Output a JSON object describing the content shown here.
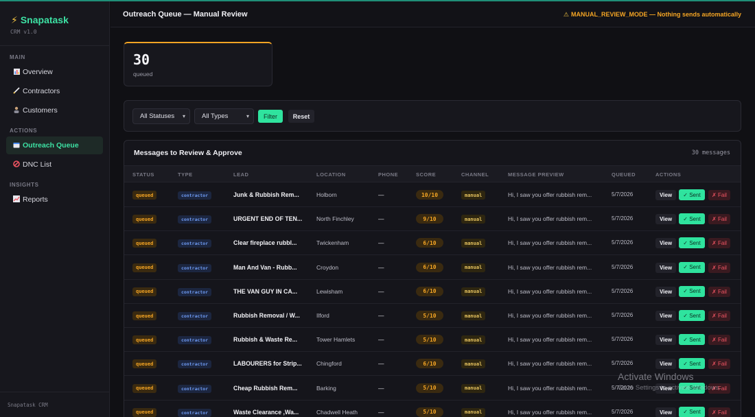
{
  "app": {
    "name": "Snapatask",
    "version": "CRM v1.0",
    "footer": "Snapatask CRM"
  },
  "sidebar": {
    "sections": [
      {
        "label": "MAIN",
        "items": [
          {
            "label": "Overview",
            "icon": "bar-chart-icon"
          },
          {
            "label": "Contractors",
            "icon": "pencil-icon"
          },
          {
            "label": "Customers",
            "icon": "person-icon"
          }
        ]
      },
      {
        "label": "ACTIONS",
        "items": [
          {
            "label": "Outreach Queue",
            "icon": "inbox-icon",
            "active": true
          },
          {
            "label": "DNC List",
            "icon": "no-entry-icon"
          }
        ]
      },
      {
        "label": "INSIGHTS",
        "items": [
          {
            "label": "Reports",
            "icon": "trend-chart-icon"
          }
        ]
      }
    ]
  },
  "header": {
    "title": "Outreach Queue — Manual Review",
    "mode_warning": "MANUAL_REVIEW_MODE — Nothing sends automatically"
  },
  "stat": {
    "value": "30",
    "label": "queued"
  },
  "filters": {
    "status_select": "All Statuses",
    "type_select": "All Types",
    "filter_label": "Filter",
    "reset_label": "Reset"
  },
  "table": {
    "title": "Messages to Review & Approve",
    "count": "30 messages",
    "columns": [
      "STATUS",
      "TYPE",
      "LEAD",
      "LOCATION",
      "PHONE",
      "SCORE",
      "CHANNEL",
      "MESSAGE PREVIEW",
      "QUEUED",
      "ACTIONS"
    ],
    "action_labels": {
      "view": "View",
      "sent": "✓ Sent",
      "fail": "✗ Fail"
    },
    "rows": [
      {
        "status": "queued",
        "type": "contractor",
        "lead": "Junk & Rubbish Rem...",
        "location": "Holborn",
        "phone": "—",
        "score": "10/10",
        "channel": "manual",
        "preview": "Hi, I saw you offer rubbish rem...",
        "queued": "5/7/2026"
      },
      {
        "status": "queued",
        "type": "contractor",
        "lead": "URGENT END OF TEN...",
        "location": "North Finchley",
        "phone": "—",
        "score": "9/10",
        "channel": "manual",
        "preview": "Hi, I saw you offer rubbish rem...",
        "queued": "5/7/2026"
      },
      {
        "status": "queued",
        "type": "contractor",
        "lead": "Clear fireplace rubbl...",
        "location": "Twickenham",
        "phone": "—",
        "score": "6/10",
        "channel": "manual",
        "preview": "Hi, I saw you offer rubbish rem...",
        "queued": "5/7/2026"
      },
      {
        "status": "queued",
        "type": "contractor",
        "lead": "Man And Van - Rubb...",
        "location": "Croydon",
        "phone": "—",
        "score": "6/10",
        "channel": "manual",
        "preview": "Hi, I saw you offer rubbish rem...",
        "queued": "5/7/2026"
      },
      {
        "status": "queued",
        "type": "contractor",
        "lead": "THE VAN GUY IN CA...",
        "location": "Lewisham",
        "phone": "—",
        "score": "6/10",
        "channel": "manual",
        "preview": "Hi, I saw you offer rubbish rem...",
        "queued": "5/7/2026"
      },
      {
        "status": "queued",
        "type": "contractor",
        "lead": "Rubbish Removal / W...",
        "location": "Ilford",
        "phone": "—",
        "score": "5/10",
        "channel": "manual",
        "preview": "Hi, I saw you offer rubbish rem...",
        "queued": "5/7/2026"
      },
      {
        "status": "queued",
        "type": "contractor",
        "lead": "Rubbish & Waste Re...",
        "location": "Tower Hamlets",
        "phone": "—",
        "score": "5/10",
        "channel": "manual",
        "preview": "Hi, I saw you offer rubbish rem...",
        "queued": "5/7/2026"
      },
      {
        "status": "queued",
        "type": "contractor",
        "lead": "LABOURERS for Strip...",
        "location": "Chingford",
        "phone": "—",
        "score": "6/10",
        "channel": "manual",
        "preview": "Hi, I saw you offer rubbish rem...",
        "queued": "5/7/2026"
      },
      {
        "status": "queued",
        "type": "contractor",
        "lead": "Cheap Rubbish Rem...",
        "location": "Barking",
        "phone": "—",
        "score": "5/10",
        "channel": "manual",
        "preview": "Hi, I saw you offer rubbish rem...",
        "queued": "5/7/2026"
      },
      {
        "status": "queued",
        "type": "contractor",
        "lead": "Waste Clearance ,Wa...",
        "location": "Chadwell Heath",
        "phone": "—",
        "score": "5/10",
        "channel": "manual",
        "preview": "Hi, I saw you offer rubbish rem...",
        "queued": "5/7/2026"
      }
    ]
  },
  "watermark": {
    "title": "Activate Windows",
    "subtitle": "Go to Settings to activate Windows."
  },
  "colors": {
    "accent": "#2fe39e",
    "warning": "#f5a524",
    "danger": "#f05563",
    "info": "#6f9cf5"
  }
}
